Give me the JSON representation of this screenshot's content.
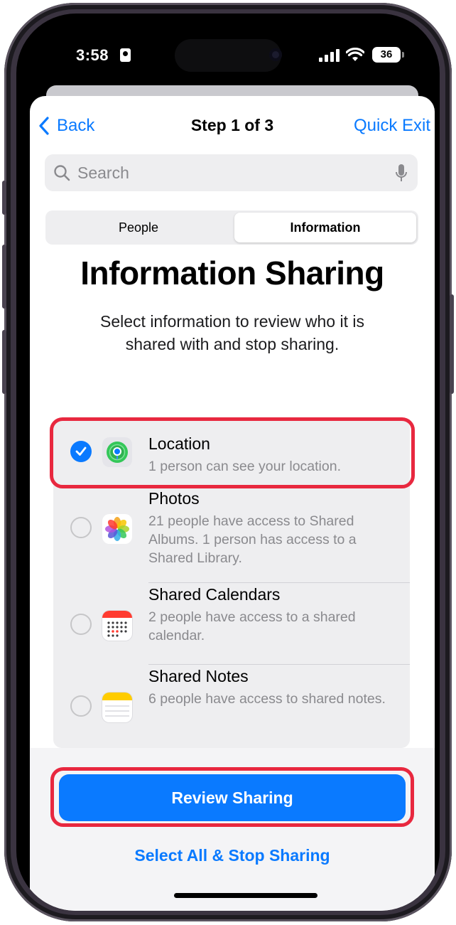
{
  "status_bar": {
    "time": "3:58",
    "battery": "36",
    "icons": [
      "contact-card-icon",
      "cellular-signal-icon",
      "wifi-icon",
      "battery-icon"
    ]
  },
  "nav": {
    "back_label": "Back",
    "step_label": "Step 1 of 3",
    "quick_exit_label": "Quick Exit"
  },
  "search": {
    "placeholder": "Search",
    "value": ""
  },
  "segmented": {
    "options": [
      "People",
      "Information"
    ],
    "selected": "Information"
  },
  "header": {
    "title": "Information Sharing",
    "subtitle": "Select information to review who it is shared with and stop sharing."
  },
  "items": [
    {
      "name": "Location",
      "description": "1 person can see your location.",
      "icon": "find-my-icon",
      "selected": true
    },
    {
      "name": "Photos",
      "description": "21 people have access to Shared Albums. 1 person has access to a Shared Library.",
      "icon": "photos-icon",
      "selected": false
    },
    {
      "name": "Shared Calendars",
      "description": "2 people have access to a shared calendar.",
      "icon": "calendar-icon",
      "selected": false
    },
    {
      "name": "Shared Notes",
      "description": "6 people have access to shared notes.",
      "icon": "notes-icon",
      "selected": false
    }
  ],
  "actions": {
    "review_label": "Review Sharing",
    "select_all_label": "Select All & Stop Sharing"
  },
  "colors": {
    "accent": "#0a7aff",
    "highlight": "#e8283f",
    "list_background": "#eeeef0"
  }
}
